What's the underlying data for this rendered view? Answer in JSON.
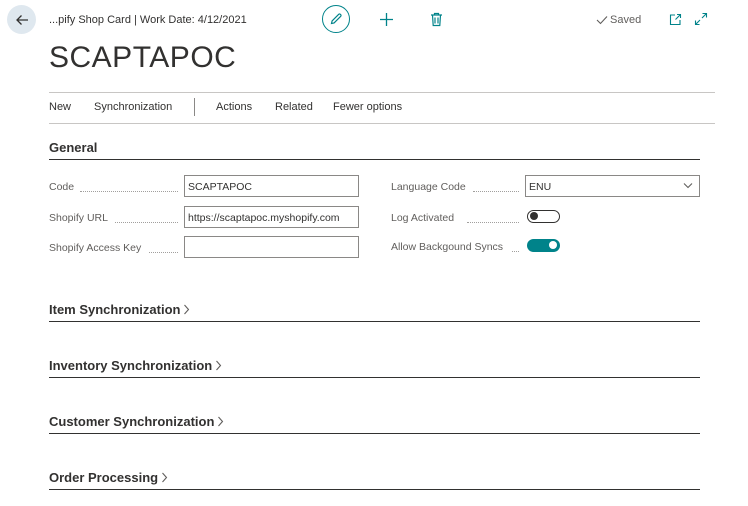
{
  "header": {
    "breadcrumb": "...pify Shop Card | Work Date: 4/12/2021",
    "saved_label": "Saved",
    "title": "SCAPTAPOC"
  },
  "actions": {
    "new": "New",
    "synchronization": "Synchronization",
    "actions": "Actions",
    "related": "Related",
    "fewer_options": "Fewer options"
  },
  "general": {
    "heading": "General",
    "code": {
      "label": "Code",
      "value": "SCAPTAPOC"
    },
    "shopify_url": {
      "label": "Shopify URL",
      "value": "https://scaptapoc.myshopify.com"
    },
    "access_key": {
      "label": "Shopify Access Key",
      "value": ""
    },
    "language_code": {
      "label": "Language Code",
      "value": "ENU"
    },
    "log_activated": {
      "label": "Log Activated",
      "on": false
    },
    "allow_background_syncs": {
      "label": "Allow Backgound Syncs",
      "on": true
    }
  },
  "sections": {
    "item_sync": "Item Synchronization",
    "inventory_sync": "Inventory Synchronization",
    "customer_sync": "Customer Synchronization",
    "order_processing": "Order Processing"
  },
  "colors": {
    "accent": "#00838a",
    "back_button_bg": "#dfe8ef"
  }
}
